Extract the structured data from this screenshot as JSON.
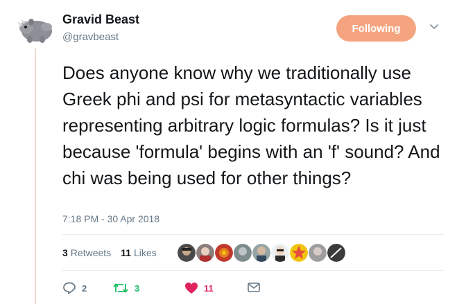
{
  "author": {
    "display_name": "Gravid Beast",
    "handle": "@gravbeast",
    "avatar_icon": "rhino-plush-avatar"
  },
  "follow_button": {
    "label": "Following",
    "color": "#f4a57f"
  },
  "menu_icon": "chevron-down-icon",
  "tweet": {
    "text": "Does anyone know why we traditionally use Greek phi and psi for metasyntactic variables representing arbitrary logic formulas? Is it just because 'formula' begins with an 'f' sound? And chi was being used for other things?",
    "timestamp": "7:18 PM - 30 Apr 2018"
  },
  "stats": {
    "retweets_count": "3",
    "retweets_label": "Retweets",
    "likes_count": "11",
    "likes_label": "Likes"
  },
  "liker_avatars": [
    {
      "icon": "person-avatar-1",
      "color": "#4a4a4a"
    },
    {
      "icon": "person-avatar-2",
      "color": "#8a7f7a"
    },
    {
      "icon": "person-avatar-3",
      "color": "#c0392b"
    },
    {
      "icon": "person-avatar-4",
      "color": "#7f8c8d"
    },
    {
      "icon": "person-avatar-5",
      "color": "#95a5a6"
    },
    {
      "icon": "person-avatar-6",
      "color": "#2c2c2c"
    },
    {
      "icon": "person-avatar-7",
      "color": "#f1c40f"
    },
    {
      "icon": "person-avatar-8",
      "color": "#9e9e9e"
    },
    {
      "icon": "person-avatar-9",
      "color": "#3a3a3a"
    }
  ],
  "actions": {
    "reply": {
      "icon": "reply-icon",
      "count": "2"
    },
    "retweet": {
      "icon": "retweet-icon",
      "count": "3",
      "color": "#17bf63"
    },
    "like": {
      "icon": "heart-icon",
      "count": "11",
      "color": "#e0245e"
    },
    "message": {
      "icon": "envelope-icon"
    }
  }
}
